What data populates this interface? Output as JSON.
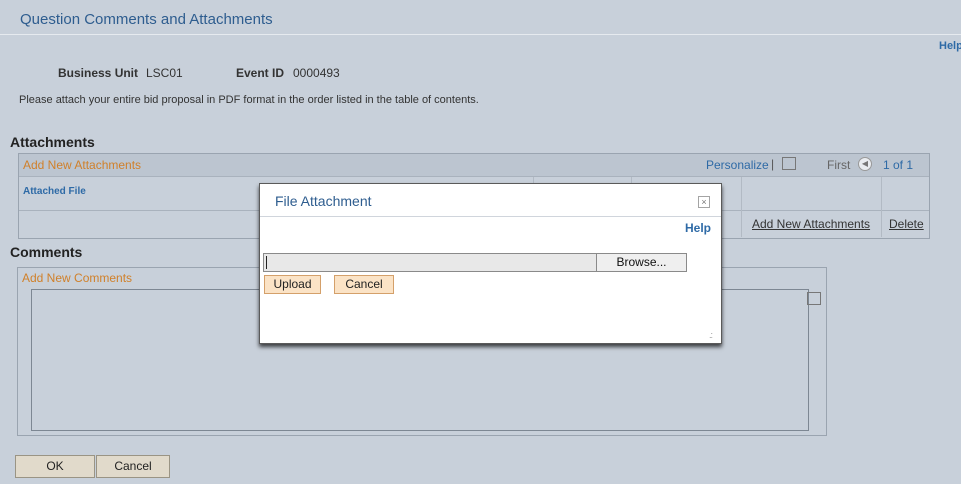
{
  "page": {
    "title": "Question Comments and Attachments",
    "help": "Help"
  },
  "header": {
    "business_unit_label": "Business Unit",
    "business_unit_value": "LSC01",
    "event_id_label": "Event ID",
    "event_id_value": "0000493",
    "instructions": "Please attach your entire bid proposal in PDF format in the order listed in the table of contents."
  },
  "attachments": {
    "section_title": "Attachments",
    "grid_title": "Add New Attachments",
    "personalize": "Personalize",
    "pipe": "|",
    "first": "First",
    "count": "1 of 1",
    "column_header": "Attached File",
    "add_button": "Add New Attachments",
    "delete_button": "Delete"
  },
  "comments": {
    "section_title": "Comments",
    "box_title": "Add New Comments"
  },
  "buttons": {
    "ok": "OK",
    "cancel": "Cancel"
  },
  "dialog": {
    "title": "File Attachment",
    "close": "×",
    "help": "Help",
    "browse": "Browse...",
    "upload": "Upload",
    "cancel": "Cancel"
  },
  "icons": {
    "zoom": "zoom-grid-icon",
    "prev": "previous-arrow-icon",
    "close": "close-icon",
    "resize": "resize-grip-icon"
  },
  "colors": {
    "background": "#c8d0da",
    "link": "#2e6aa6",
    "section_header": "#d0802a",
    "title": "#2e5d8f"
  }
}
